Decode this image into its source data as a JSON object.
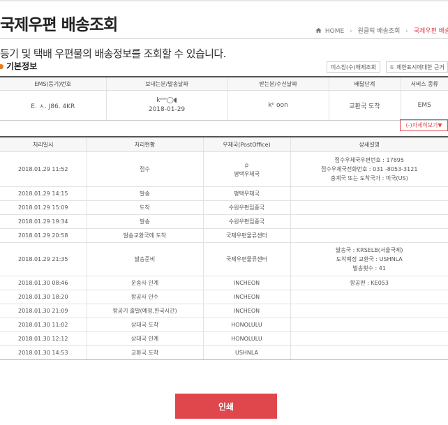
{
  "header": {
    "title": "국제우편 배송조회",
    "breadcrumb": [
      "HOME",
      "원클릭 배송조회",
      "국제우편 배송조"
    ],
    "description": "등기 및 택배 우편물의 배송정보를 조회할 수 있습니다."
  },
  "basic_info": {
    "section_title": "기본정보",
    "postage_button": "미스칭(수)해제조회",
    "restrict_button": "① 제한표시에대한 근거",
    "columns": [
      "EMS(등기)번호",
      "보내는분/발송날짜",
      "받는분/수신날짜",
      "배달단계",
      "서비스 종류"
    ],
    "row": {
      "tracking_number": "E. ㅅ. J86. 4KR",
      "sender": "kᵉᵐ◯◖",
      "send_date": "2018-01-29",
      "receiver": "kᵉ  oon",
      "stage": "교환국 도착",
      "service": "EMS"
    }
  },
  "detail_toggle": "(-)자세히보기▼",
  "details": {
    "columns": [
      "처리일시",
      "처리현황",
      "우체국(PostOffice)",
      "상세설명"
    ],
    "rows": [
      {
        "datetime": "2018.01.29 11:52",
        "status": "접수",
        "office": "평택우체국",
        "office_note": "p",
        "detail": [
          "접수우체국우편번호 : 17895",
          "접수우체국전화번호 : 031 -8053-3121",
          "충계국 또는 도착국가 : 미국(US)"
        ]
      },
      {
        "datetime": "2018.01.29 14:15",
        "status": "발송",
        "office": "평택우체국",
        "detail": []
      },
      {
        "datetime": "2018.01.29 15:09",
        "status": "도착",
        "office": "수원우편집중국",
        "detail": []
      },
      {
        "datetime": "2018.01.29 19:34",
        "status": "발송",
        "office": "수원우편집중국",
        "detail": []
      },
      {
        "datetime": "2018.01.29 20:58",
        "status": "발송교환국에 도착",
        "office": "국제우편물류센터",
        "detail": []
      },
      {
        "datetime": "2018.01.29 21:35",
        "status": "발송준비",
        "office": "국제우편물류센터",
        "detail": [
          "발송국 : KRSELB(서울국제)",
          "도착예정 교환국 : USHNLA",
          "발송횟수 : 41"
        ]
      },
      {
        "datetime": "2018.01.30 08:46",
        "status": "운송사 인계",
        "office": "INCHEON",
        "detail": [
          "항공편 : KE053"
        ]
      },
      {
        "datetime": "2018.01.30 18:20",
        "status": "항공사 인수",
        "office": "INCHEON",
        "detail": []
      },
      {
        "datetime": "2018.01.30 21:09",
        "status": "항공기 출발(예정,한국시간)",
        "office": "INCHEON",
        "detail": []
      },
      {
        "datetime": "2018.01.30 11:02",
        "status": "상대국 도착",
        "office": "HONOLULU",
        "detail": []
      },
      {
        "datetime": "2018.01.30 12:12",
        "status": "상대국 인계",
        "office": "HONOLULU",
        "detail": []
      },
      {
        "datetime": "2018.01.30 14:53",
        "status": "교환국 도착",
        "office": "USHNLA",
        "detail": []
      }
    ]
  },
  "print_button": "인쇄",
  "colors": {
    "accent": "#e0474c",
    "bullet": "#e97b1f",
    "header_bg": "#f7f7f7"
  },
  "icons": [
    "home-icon",
    "bullet-icon"
  ]
}
